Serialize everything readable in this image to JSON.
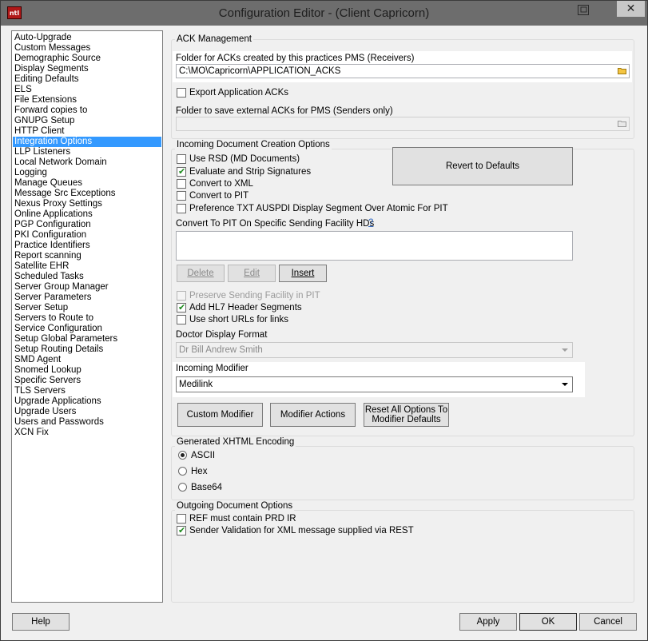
{
  "window": {
    "title": "Configuration Editor -  (Client Capricorn)",
    "app_icon_text": "ntl",
    "close_glyph": "✕",
    "icons": [
      "app-icon",
      "restore-icon",
      "close-icon",
      "folder-icon",
      "checkmark-icon",
      "chevron-down-icon"
    ],
    "colors": {
      "titlebar": "#6d6d6d",
      "selection": "#3399ff",
      "check": "#1c8a1c",
      "link": "#3a6fc4"
    }
  },
  "sidebar": {
    "selected": "Integration Options",
    "items": [
      "Auto-Upgrade",
      "Custom Messages",
      "Demographic Source",
      "Display Segments",
      "Editing Defaults",
      "ELS",
      "File Extensions",
      "Forward copies to",
      "GNUPG Setup",
      "HTTP Client",
      "Integration Options",
      "LLP Listeners",
      "Local Network Domain",
      "Logging",
      "Manage Queues",
      "Message Src Exceptions",
      "Nexus Proxy Settings",
      "Online Applications",
      "PGP Configuration",
      "PKI Configuration",
      "Practice Identifiers",
      "Report scanning",
      "Satellite EHR",
      "Scheduled Tasks",
      "Server Group Manager",
      "Server Parameters",
      "Server Setup",
      "Servers to Route to",
      "Service Configuration",
      "Setup Global Parameters",
      "Setup Routing Details",
      "SMD Agent",
      "Snomed Lookup",
      "Specific Servers",
      "TLS Servers",
      "Upgrade Applications",
      "Upgrade Users",
      "Users and Passwords",
      "XCN Fix"
    ]
  },
  "ack": {
    "title": "ACK Management",
    "folder_label": "Folder for ACKs created by this practices PMS (Receivers)",
    "folder_value": "C:\\MO\\Capricorn\\APPLICATION_ACKS",
    "export_label": "Export Application ACKs",
    "export_checked": false,
    "external_label": "Folder to save external ACKs for PMS (Senders only)",
    "external_value": ""
  },
  "incoming": {
    "title": "Incoming Document Creation Options",
    "options": [
      {
        "label": "Use RSD (MD Documents)",
        "checked": false
      },
      {
        "label": "Evaluate and Strip Signatures",
        "checked": true
      },
      {
        "label": "Convert to XML",
        "checked": false
      },
      {
        "label": "Convert to PIT",
        "checked": false
      },
      {
        "label": "Preference TXT AUSPDI Display Segment Over Atomic For PIT",
        "checked": false
      }
    ],
    "revert_label": "Revert to Defaults",
    "pit_label": "Convert To PIT On Specific Sending Facility HDs",
    "pit_help": "?",
    "delete_label": "Delete",
    "edit_label": "Edit",
    "insert_label": "Insert",
    "preserve_label": "Preserve Sending Facility in PIT",
    "preserve_checked": false,
    "hl7_label": "Add HL7 Header Segments",
    "hl7_checked": true,
    "shorturl_label": "Use short URLs for links",
    "shorturl_checked": false,
    "doctor_label": "Doctor Display Format",
    "doctor_value": "Dr Bill Andrew Smith",
    "modifier_label": "Incoming Modifier",
    "modifier_value": "Medilink",
    "custom_modifier_label": "Custom Modifier",
    "modifier_actions_label": "Modifier Actions",
    "reset_line1": "Reset All Options To",
    "reset_line2": "Modifier Defaults"
  },
  "xhtml": {
    "title": "Generated XHTML Encoding",
    "options": [
      "ASCII",
      "Hex",
      "Base64"
    ],
    "selected": "ASCII"
  },
  "outgoing": {
    "title": "Outgoing Document Options",
    "options": [
      {
        "label": "REF must contain PRD IR",
        "checked": false
      },
      {
        "label": "Sender Validation for XML message supplied via REST",
        "checked": true
      }
    ]
  },
  "footer": {
    "help_label": "Help",
    "apply_label": "Apply",
    "ok_label": "OK",
    "cancel_label": "Cancel"
  }
}
